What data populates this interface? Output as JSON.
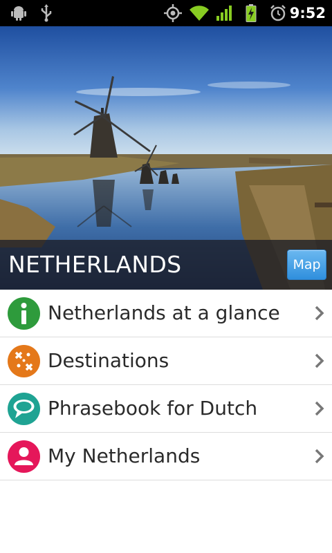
{
  "status_bar": {
    "time": "9:52",
    "icons": [
      "android-debug-icon",
      "usb-icon",
      "gps-icon",
      "wifi-icon",
      "signal-icon",
      "battery-charging-icon",
      "alarm-icon"
    ]
  },
  "hero": {
    "title": "NETHERLANDS",
    "map_button_label": "Map"
  },
  "menu": {
    "items": [
      {
        "label": "Netherlands at a glance",
        "icon": "info-icon",
        "color": "#2e9b3c"
      },
      {
        "label": "Destinations",
        "icon": "destinations-icon",
        "color": "#e4781a"
      },
      {
        "label": "Phrasebook for Dutch",
        "icon": "speech-bubble-icon",
        "color": "#1fa393"
      },
      {
        "label": "My Netherlands",
        "icon": "person-icon",
        "color": "#e5175a"
      }
    ]
  }
}
